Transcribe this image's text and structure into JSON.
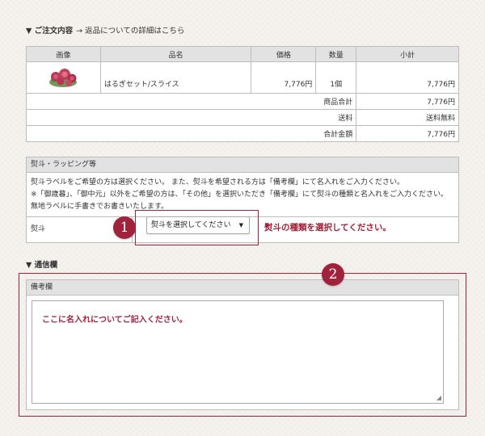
{
  "order_section": {
    "title": "▼ ご注文内容",
    "return_link": "→ 返品についての詳細はこちら",
    "headers": [
      "画像",
      "品名",
      "価格",
      "数量",
      "小計"
    ],
    "item": {
      "name": "はるぎセット/スライス",
      "price": "7,776円",
      "qty": "1個",
      "subtotal": "7,776円"
    },
    "summary": [
      {
        "label": "商品合計",
        "value": "7,776円"
      },
      {
        "label": "送料",
        "value": "送料無料"
      },
      {
        "label": "合計金額",
        "value": "7,776円"
      }
    ]
  },
  "noshi_section": {
    "title": "熨斗・ラッピング等",
    "desc1": "熨斗ラベルをご希望の方は選択ください。 また、熨斗を希望される方は「備考欄」にて名入れをご入力ください。",
    "desc2": "※「御歳暮」、「御中元」以外をご希望の方は、「その他」を選択いただき「備考欄」にて熨斗の種類と名入れをご入力ください。 無地ラベルに手書きでお書きいたします。",
    "label": "熨斗",
    "select_value": "熨斗を選択してください",
    "callout": "熨斗の種類を選択してください。",
    "badge": "1"
  },
  "memo_section": {
    "title": "▼ 通信欄",
    "box_title": "備考欄",
    "placeholder": "ここに名入れについてご記入ください。",
    "badge": "2"
  },
  "colors": {
    "accent": "#a0233b",
    "header_bg": "#e2e2e2",
    "border": "#bdbdbd"
  }
}
